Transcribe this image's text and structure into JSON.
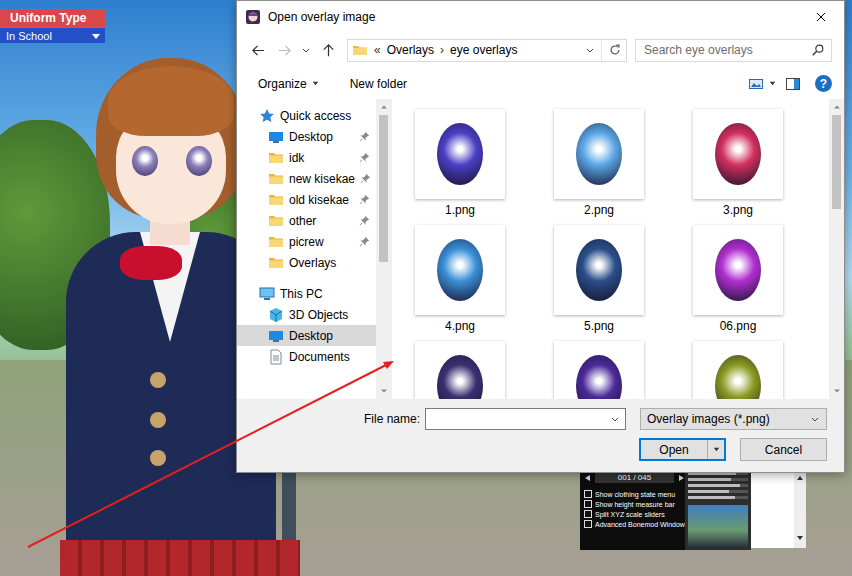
{
  "game": {
    "uniform": {
      "label": "Uniform Type",
      "value": "In School"
    },
    "pager": {
      "counter": "001 / 045"
    },
    "options": [
      {
        "label": "Show clothing state menu",
        "checked": false
      },
      {
        "label": "Show height measure bar",
        "checked": false
      },
      {
        "label": "Split XYZ scale sliders",
        "checked": false
      },
      {
        "label": "Advanced Bonemod Window",
        "checked": false
      }
    ],
    "sliders": [
      {
        "level": 0.8
      },
      {
        "level": 0.72
      },
      {
        "level": 0.86
      },
      {
        "level": 0.68
      },
      {
        "level": 0.78
      }
    ]
  },
  "dialog": {
    "title": "Open overlay image",
    "address": {
      "prefix": "«",
      "separator": "›",
      "path": [
        "Overlays",
        "eye overlays"
      ]
    },
    "search": {
      "placeholder": "Search eye overlays"
    },
    "toolbar": {
      "organize": "Organize",
      "new_folder": "New folder",
      "help": "?"
    },
    "nav": {
      "scroll_level": 0.55,
      "items": [
        {
          "label": "Quick access",
          "kind": "quick-access",
          "pinned": false,
          "selected": false
        },
        {
          "label": "Desktop",
          "kind": "desktop",
          "pinned": true,
          "selected": false
        },
        {
          "label": "idk",
          "kind": "folder",
          "pinned": true,
          "selected": false
        },
        {
          "label": "new kisekae",
          "kind": "folder",
          "pinned": true,
          "selected": false
        },
        {
          "label": "old kisekae",
          "kind": "folder",
          "pinned": true,
          "selected": false
        },
        {
          "label": "other",
          "kind": "folder",
          "pinned": true,
          "selected": false
        },
        {
          "label": "picrew",
          "kind": "folder",
          "pinned": true,
          "selected": false
        },
        {
          "label": "Overlays",
          "kind": "folder",
          "pinned": false,
          "selected": false
        },
        {
          "label": "This PC",
          "kind": "this-pc",
          "pinned": false,
          "selected": false
        },
        {
          "label": "3D Objects",
          "kind": "objects-3d",
          "pinned": false,
          "selected": false
        },
        {
          "label": "Desktop",
          "kind": "desktop",
          "pinned": false,
          "selected": true
        },
        {
          "label": "Documents",
          "kind": "documents",
          "pinned": false,
          "selected": false
        }
      ]
    },
    "files": {
      "scroll_level": 0.35,
      "items": [
        {
          "label": "1.png",
          "color": "#4b3fc4"
        },
        {
          "label": "2.png",
          "color": "#5aa6e6"
        },
        {
          "label": "3.png",
          "color": "#d2305e"
        },
        {
          "label": "4.png",
          "color": "#3a8fd6"
        },
        {
          "label": "5.png",
          "color": "#2a4f8a"
        },
        {
          "label": "06.png",
          "color": "#b030d0"
        },
        {
          "color": "#3a3070"
        },
        {
          "color": "#4a2a9a"
        },
        {
          "color": "#8a9a20"
        }
      ]
    },
    "file_name": {
      "label": "File name:",
      "value": ""
    },
    "file_type": "Overlay images (*.png)",
    "buttons": [
      {
        "label": "Open",
        "default": true,
        "split": true
      },
      {
        "label": "Cancel",
        "default": false,
        "split": false
      }
    ]
  }
}
